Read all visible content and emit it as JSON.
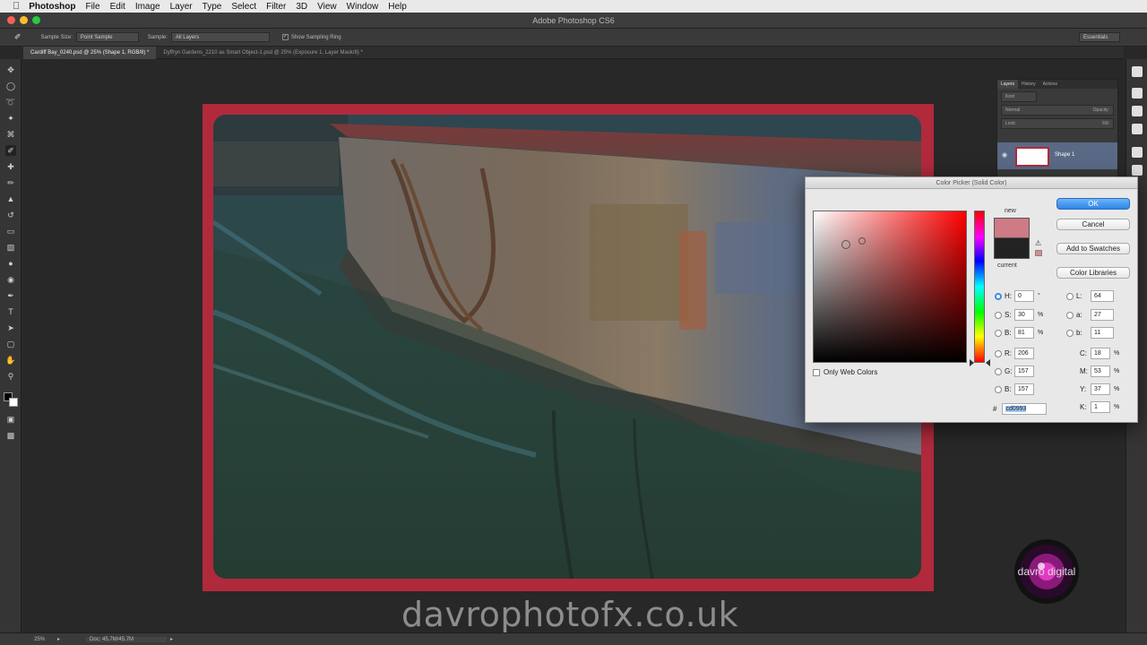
{
  "menubar": {
    "items": [
      "Photoshop",
      "File",
      "Edit",
      "Image",
      "Layer",
      "Type",
      "Select",
      "Filter",
      "3D",
      "View",
      "Window",
      "Help"
    ]
  },
  "window": {
    "title": "Adobe Photoshop CS6"
  },
  "options_bar": {
    "sample_size_label": "Sample Size:",
    "sample_size_value": "Point Sample",
    "sample_label": "Sample:",
    "sample_value": "All Layers",
    "show_ring_label": "Show Sampling Ring",
    "workspace_value": "Essentials"
  },
  "doc_tabs": [
    {
      "label": "Cardiff Bay_0240.psd @ 25% (Shape 1, RGB/8) *",
      "active": true
    },
    {
      "label": "Dyffryn Gardens_2210 as Smart Object-1.psd @ 25% (Exposure 1, Layer Mask/8) *",
      "active": false
    }
  ],
  "layers_panel": {
    "tabs": [
      "Layers",
      "History",
      "Actions"
    ],
    "kind_label": "Kind",
    "blend_mode": "Normal",
    "opacity_label": "Opacity:",
    "lock_label": "Lock:",
    "fill_label": "Fill:",
    "layer_name": "Shape 1"
  },
  "color_picker": {
    "title": "Color Picker (Solid Color)",
    "new_label": "new",
    "current_label": "current",
    "new_color": "#ce7b85",
    "current_color": "#222222",
    "buttons": {
      "ok": "OK",
      "cancel": "Cancel",
      "add_swatches": "Add to Swatches",
      "color_libraries": "Color Libraries"
    },
    "only_web_colors": "Only Web Colors",
    "hsb": [
      {
        "k": "H:",
        "v": "0",
        "u": "°",
        "selected": true
      },
      {
        "k": "S:",
        "v": "30",
        "u": "%",
        "selected": false
      },
      {
        "k": "B:",
        "v": "81",
        "u": "%",
        "selected": false
      }
    ],
    "rgb": [
      {
        "k": "R:",
        "v": "206"
      },
      {
        "k": "G:",
        "v": "157"
      },
      {
        "k": "B:",
        "v": "157"
      }
    ],
    "lab": [
      {
        "k": "L:",
        "v": "64"
      },
      {
        "k": "a:",
        "v": "27"
      },
      {
        "k": "b:",
        "v": "11"
      }
    ],
    "cmyk": [
      {
        "k": "C:",
        "v": "18",
        "u": "%"
      },
      {
        "k": "M:",
        "v": "53",
        "u": "%"
      },
      {
        "k": "Y:",
        "v": "37",
        "u": "%"
      },
      {
        "k": "K:",
        "v": "1",
        "u": "%"
      }
    ],
    "hex_label": "#",
    "hex_value": "cd0993"
  },
  "status_bar": {
    "zoom": "25%",
    "doc_info": "Doc: 45.7M/45.7M"
  },
  "watermark": {
    "text": "davrophotofx.co.uk"
  },
  "logo": {
    "text": "davro digital"
  },
  "colors": {
    "frame": "#b02a3c",
    "accent": "#3b8ce6"
  }
}
